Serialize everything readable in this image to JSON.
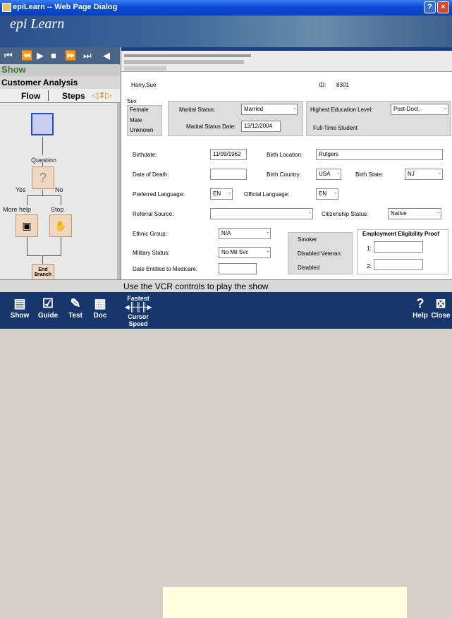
{
  "window": {
    "title": "epiLearn -- Web Page Dialog"
  },
  "banner": {
    "logo": "epi Learn"
  },
  "sidebar": {
    "show_label": "Show",
    "customer_label": "Customer Analysis",
    "tabs": [
      "Flow",
      "Steps"
    ]
  },
  "flow": {
    "question": "Question",
    "yes": "Yes",
    "no": "No",
    "more_help": "More help",
    "stop": "Stop",
    "end_branch": "End Branch"
  },
  "form": {
    "name": "Harry,Sue",
    "id_label": "ID:",
    "id_value": "8301",
    "sex_label": "Sex",
    "sex_options": [
      "Female",
      "Male",
      "Unknown"
    ],
    "marital_status_label": "Marital Status:",
    "marital_status": "Married",
    "marital_date_label": "Marital Status Date:",
    "marital_date": "12/12/2004",
    "education_label": "Highest Education Level:",
    "education": "Post-Doct.",
    "fulltime_label": "Full-Time Student",
    "birthdate_label": "Birthdate:",
    "birthdate": "11/09/1962",
    "birth_location_label": "Birth Location:",
    "birth_location": "Rutgers",
    "death_label": "Date of Death:",
    "birth_country_label": "Birth Country:",
    "birth_country": "USA",
    "birth_state_label": "Birth State:",
    "birth_state": "NJ",
    "pref_lang_label": "Preferred Language:",
    "pref_lang": "EN",
    "official_lang_label": "Official Language:",
    "official_lang": "EN",
    "referral_label": "Referral Source:",
    "citizenship_label": "Citizenship Status:",
    "citizenship": "Native",
    "ethnic_label": "Ethnic Group:",
    "ethnic": "N/A",
    "smoker_label": "Smoker",
    "veteran_label": "Disabled Veteran",
    "disabled_label": "Disabled",
    "employment_label": "Employment Eligibility Proof",
    "emp1": "1:",
    "emp2": "2:",
    "military_label": "Military Status:",
    "military": "No Mil Svc",
    "medicare_label": "Date Entitled to Medicare:"
  },
  "status": {
    "text": "Use the VCR controls to play the show"
  },
  "toolbar": {
    "show": "Show",
    "guide": "Guide",
    "test": "Test",
    "doc": "Doc",
    "speed": "Fastest",
    "cursor": "Cursor Speed",
    "help": "Help",
    "close": "Close"
  }
}
